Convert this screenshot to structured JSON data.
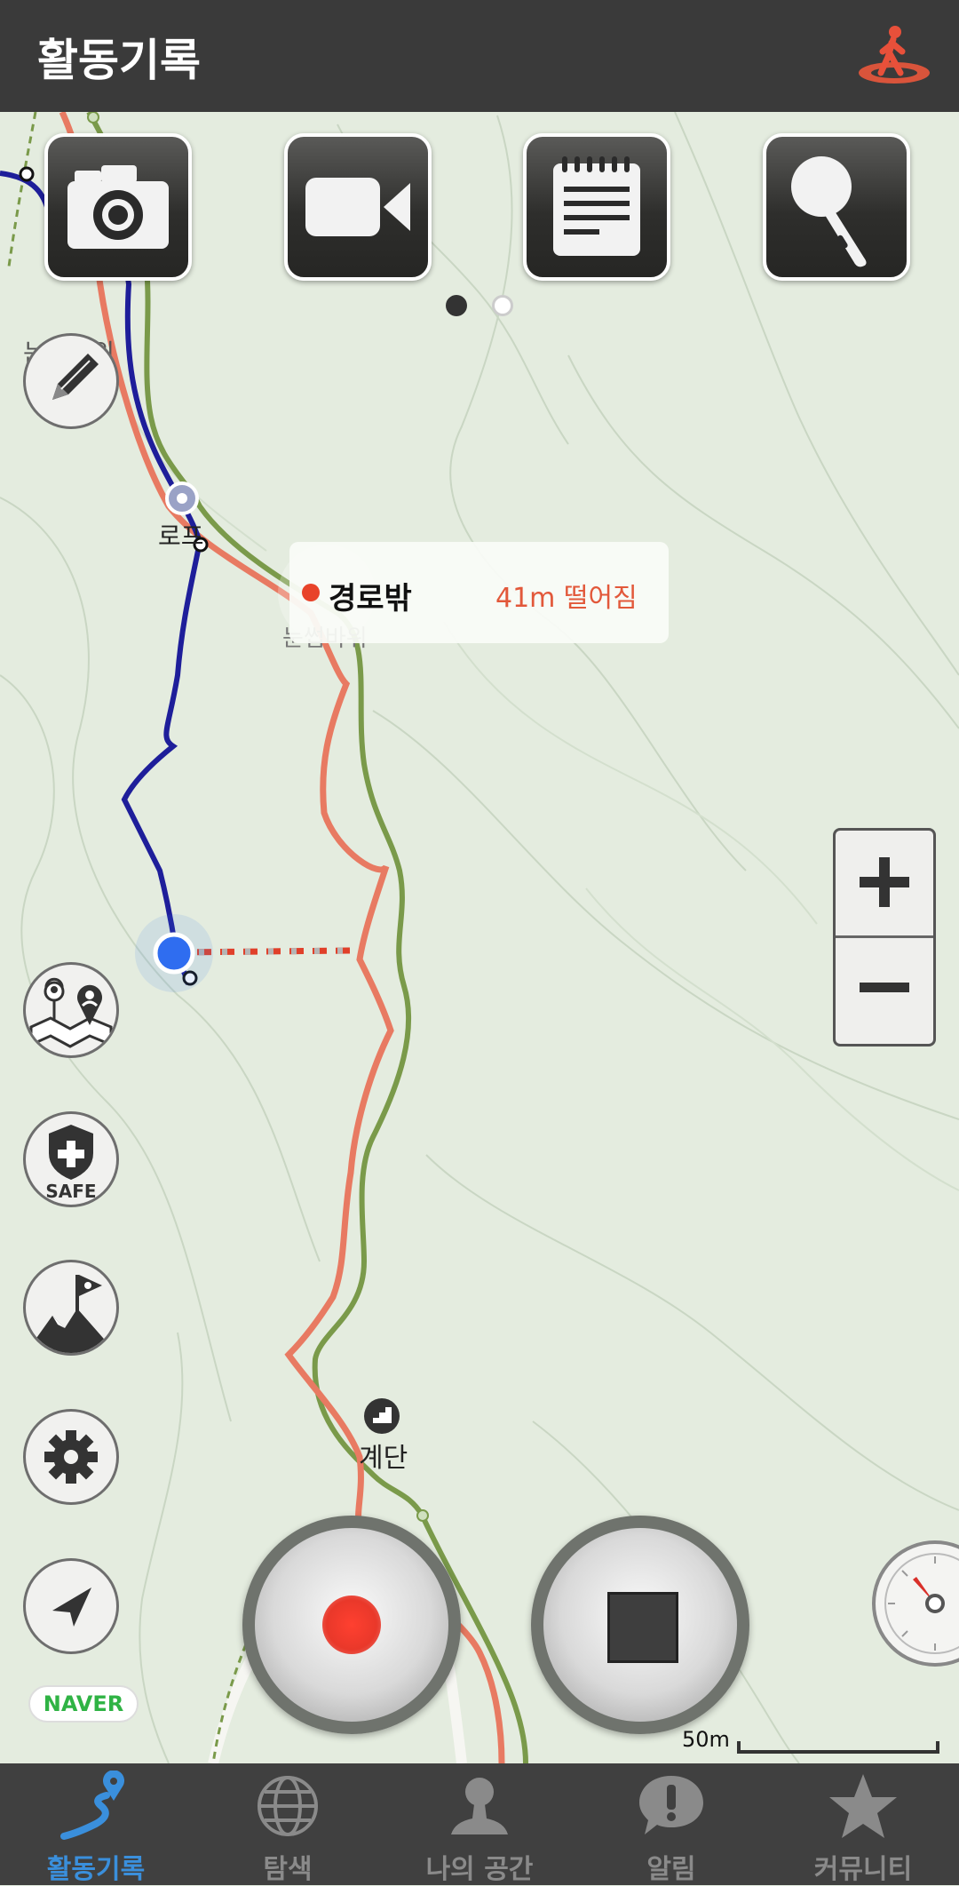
{
  "header": {
    "title": "활동기록"
  },
  "media_buttons": [
    "camera-icon",
    "video-icon",
    "memo-icon",
    "microphone-icon"
  ],
  "pager": {
    "count": 2,
    "active": 1
  },
  "map_labels": {
    "rock1": "눈썹바위",
    "rope": "로프",
    "rock2": "눈썹바위",
    "stairs": "계단"
  },
  "tooltip": {
    "status": "경로밖",
    "distance": "41m 떨어짐"
  },
  "side_buttons": [
    "pencil-icon",
    "map-users-icon",
    "safe-shield-icon",
    "summit-flag-icon",
    "gear-icon",
    "navigate-arrow-icon"
  ],
  "safe_label": "SAFE",
  "zoom": {
    "in": "+",
    "out": "−"
  },
  "naver": "NAVER",
  "scale": {
    "label": "50m"
  },
  "controls": {
    "record": "record-icon",
    "stop": "stop-icon"
  },
  "colors": {
    "record": "#e9382a",
    "active_tab": "#3a8fdc",
    "track_planned": "#e87a62",
    "track_trail": "#7a9a4a",
    "track_walked": "#1e1e9a"
  },
  "nav": [
    {
      "label": "활동기록",
      "icon": "track-pin-icon",
      "active": true
    },
    {
      "label": "탐색",
      "icon": "globe-icon",
      "active": false
    },
    {
      "label": "나의 공간",
      "icon": "person-icon",
      "active": false
    },
    {
      "label": "알림",
      "icon": "alert-bubble-icon",
      "active": false
    },
    {
      "label": "커뮤니티",
      "icon": "star-icon",
      "active": false
    }
  ]
}
